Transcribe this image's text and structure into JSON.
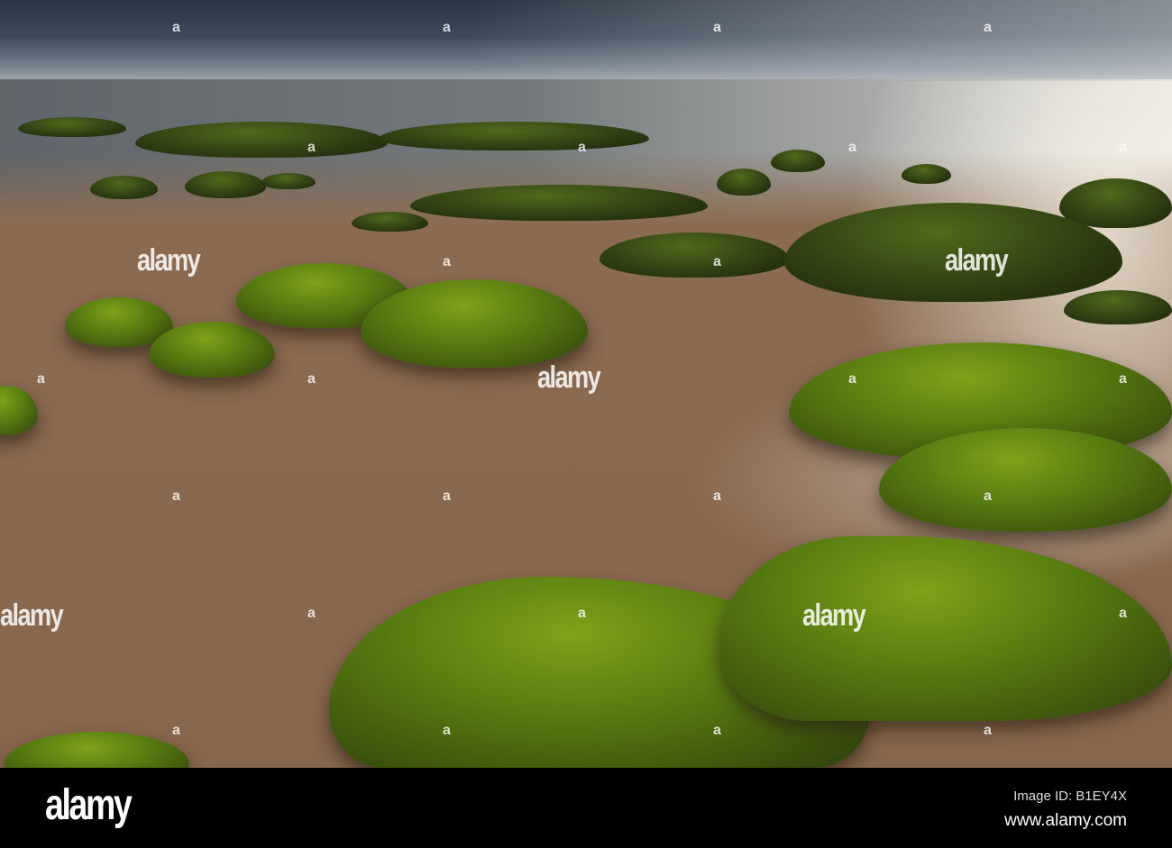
{
  "watermark": {
    "text": "alamy",
    "mark": "a"
  },
  "footer": {
    "logo": "alamy",
    "image_id": "Image ID: B1EY4X",
    "url": "www.alamy.com"
  }
}
